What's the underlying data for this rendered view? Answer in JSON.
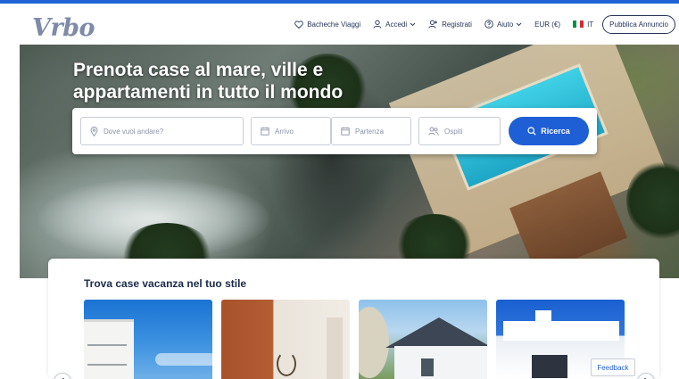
{
  "brand": {
    "logo": "Vrbo"
  },
  "header": {
    "nav": {
      "boards": "Bacheche Viaggi",
      "login": "Accedi",
      "register": "Registrati",
      "help": "Aiuto",
      "currency": "EUR (€)",
      "language": "IT",
      "publish": "Pubblica Annuncio"
    }
  },
  "hero": {
    "title": "Prenota case al mare, ville e appartamenti in tutto il mondo"
  },
  "search": {
    "destination_placeholder": "Dove vuoi andare?",
    "checkin_placeholder": "Arrivo",
    "checkout_placeholder": "Partenza",
    "guests_placeholder": "Ospiti",
    "button_label": "Ricerca"
  },
  "section": {
    "title": "Trova case vacanza nel tuo stile"
  },
  "feedback": {
    "label": "Feedback"
  },
  "colors": {
    "accent": "#1f5fd6",
    "navy": "#243459",
    "logo": "#7e8aa8",
    "flag_green": "#009246",
    "flag_white": "#ffffff",
    "flag_red": "#ce2b37"
  },
  "icons": [
    "heart-icon",
    "user-icon",
    "chevron-down-icon",
    "user-plus-icon",
    "help-circle-icon",
    "italy-flag-icon",
    "location-pin-icon",
    "calendar-icon",
    "guests-icon",
    "search-icon",
    "chevron-left-icon",
    "chevron-right-icon"
  ]
}
